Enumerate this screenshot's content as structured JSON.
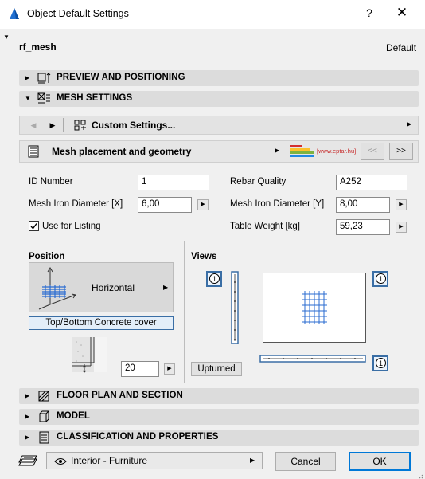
{
  "window": {
    "title": "Object Default Settings",
    "help": "?",
    "close": "✕"
  },
  "header": {
    "object_name": "rf_mesh",
    "default_label": "Default"
  },
  "sections": {
    "preview": "PREVIEW AND POSITIONING",
    "mesh": "MESH SETTINGS",
    "floor_plan": "FLOOR PLAN AND SECTION",
    "model": "MODEL",
    "classification": "CLASSIFICATION AND PROPERTIES"
  },
  "nav": {
    "custom_settings": "Custom Settings..."
  },
  "panel": {
    "title": "Mesh placement and geometry",
    "logo_text": "[www.eptar.hu]",
    "prev": "<<",
    "next": ">>"
  },
  "fields": {
    "id_label": "ID Number",
    "id_value": "1",
    "rebar_label": "Rebar Quality",
    "rebar_value": "A252",
    "diam_x_label": "Mesh Iron Diameter [X]",
    "diam_x_value": "6,00",
    "diam_y_label": "Mesh Iron Diameter [Y]",
    "diam_y_value": "8,00",
    "listing_label": "Use for Listing",
    "listing_checked": true,
    "weight_label": "Table Weight [kg]",
    "weight_value": "59,23"
  },
  "position": {
    "label": "Position",
    "orientation": "Horizontal",
    "cover_button": "Top/Bottom Concrete cover",
    "cover_value": "20"
  },
  "views": {
    "label": "Views",
    "badge_left": "1",
    "badge_right_top": "1",
    "badge_right_bottom": "1",
    "upturned": "Upturned"
  },
  "footer": {
    "layer": "Interior - Furniture",
    "cancel": "Cancel",
    "ok": "OK"
  },
  "colors": {
    "accent": "#0078d7",
    "section_bg": "#dcdcdc",
    "badge_border": "#3a6ea5"
  }
}
